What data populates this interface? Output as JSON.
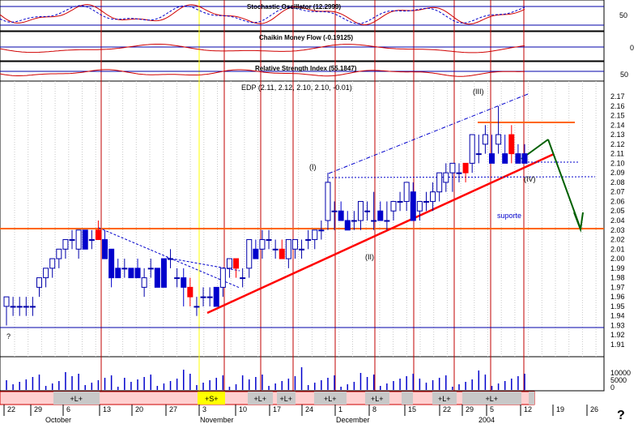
{
  "chart_data": {
    "type": "candlestick",
    "title": "EDP (2.11, 2.12, 2.10, 2.10, -0.01)",
    "price_axis": {
      "ylim": [
        1.9,
        2.18
      ],
      "ticks": [
        "2.17",
        "2.16",
        "2.15",
        "2.14",
        "2.13",
        "2.12",
        "2.11",
        "2.10",
        "2.09",
        "2.08",
        "2.07",
        "2.06",
        "2.05",
        "2.04",
        "2.03",
        "2.02",
        "2.01",
        "2.00",
        "1.99",
        "1.98",
        "1.97",
        "1.96",
        "1.95",
        "1.94",
        "1.93",
        "1.92",
        "1.91"
      ]
    },
    "volume_axis": {
      "ticks": [
        "10000",
        "5000",
        "0"
      ]
    },
    "indicators": [
      {
        "name": "Stochastic Oscillator (12.2999)",
        "axis_label": "50"
      },
      {
        "name": "Chaikin Money Flow (-0.19125)",
        "axis_label": "0"
      },
      {
        "name": "Relative Strength Index (55.1847)",
        "axis_label": "50"
      }
    ],
    "date_ticks": [
      "22",
      "29",
      "6",
      "13",
      "20",
      "27",
      "3",
      "10",
      "17",
      "24",
      "1",
      "8",
      "15",
      "22",
      "29",
      "5",
      "12",
      "19",
      "26"
    ],
    "month_labels": [
      "October",
      "November",
      "December",
      "2004"
    ],
    "candles": [
      [
        1.95,
        1.96,
        1.93,
        1.96
      ],
      [
        1.95,
        1.96,
        1.94,
        1.95
      ],
      [
        1.95,
        1.96,
        1.94,
        1.95
      ],
      [
        1.95,
        1.96,
        1.94,
        1.95
      ],
      [
        1.95,
        1.96,
        1.94,
        1.95
      ],
      [
        1.97,
        1.98,
        1.96,
        1.98
      ],
      [
        1.98,
        1.99,
        1.97,
        1.99
      ],
      [
        1.99,
        2.0,
        1.98,
        2.0
      ],
      [
        2.0,
        2.01,
        1.99,
        2.01
      ],
      [
        2.01,
        2.02,
        2.0,
        2.02
      ],
      [
        2.02,
        2.03,
        2.01,
        2.02
      ],
      [
        2.01,
        2.03,
        2.0,
        2.03
      ],
      [
        2.03,
        2.03,
        2.01,
        2.01
      ],
      [
        2.02,
        2.03,
        2.01,
        2.02
      ],
      [
        2.03,
        2.04,
        2.02,
        2.02
      ],
      [
        2.02,
        2.03,
        2.0,
        2.0
      ],
      [
        2.01,
        2.01,
        1.97,
        1.98
      ],
      [
        1.99,
        2.0,
        1.98,
        1.98
      ],
      [
        1.99,
        2.0,
        1.98,
        1.99
      ],
      [
        1.99,
        1.99,
        1.98,
        1.98
      ],
      [
        1.99,
        2.0,
        1.98,
        1.98
      ],
      [
        1.97,
        1.99,
        1.96,
        1.98
      ],
      [
        1.99,
        2.0,
        1.98,
        1.99
      ],
      [
        1.99,
        1.99,
        1.97,
        1.97
      ],
      [
        2.0,
        2.0,
        1.97,
        1.97
      ],
      [
        2.0,
        2.01,
        1.99,
        2.0
      ],
      [
        1.98,
        1.99,
        1.97,
        1.98
      ],
      [
        1.98,
        1.99,
        1.95,
        1.97
      ],
      [
        1.97,
        1.98,
        1.95,
        1.96
      ],
      [
        1.95,
        1.96,
        1.94,
        1.95
      ],
      [
        1.96,
        1.97,
        1.95,
        1.96
      ],
      [
        1.96,
        1.97,
        1.95,
        1.96
      ],
      [
        1.97,
        1.97,
        1.95,
        1.95
      ],
      [
        1.97,
        1.99,
        1.96,
        1.99
      ],
      [
        1.99,
        2.0,
        1.98,
        2.0
      ],
      [
        2.0,
        2.0,
        1.98,
        1.99
      ],
      [
        1.98,
        1.99,
        1.97,
        1.98
      ],
      [
        1.99,
        2.02,
        1.98,
        2.02
      ],
      [
        2.01,
        2.02,
        2.0,
        2.0
      ],
      [
        2.01,
        2.03,
        2.0,
        2.02
      ],
      [
        2.02,
        2.03,
        2.01,
        2.02
      ],
      [
        2.01,
        2.02,
        2.0,
        2.01
      ],
      [
        2.01,
        2.02,
        2.0,
        2.0
      ],
      [
        2.0,
        2.02,
        1.99,
        2.02
      ],
      [
        2.01,
        2.02,
        2.0,
        2.02
      ],
      [
        2.01,
        2.02,
        2.0,
        2.01
      ],
      [
        2.02,
        2.03,
        2.01,
        2.02
      ],
      [
        2.02,
        2.03,
        2.01,
        2.03
      ],
      [
        2.03,
        2.04,
        2.02,
        2.03
      ],
      [
        2.04,
        2.09,
        2.03,
        2.08
      ],
      [
        2.05,
        2.06,
        2.03,
        2.05
      ],
      [
        2.05,
        2.06,
        2.04,
        2.04
      ],
      [
        2.04,
        2.05,
        2.03,
        2.03
      ],
      [
        2.04,
        2.05,
        2.03,
        2.04
      ],
      [
        2.04,
        2.06,
        2.03,
        2.06
      ],
      [
        2.05,
        2.06,
        2.04,
        2.05
      ],
      [
        2.04,
        2.07,
        2.03,
        2.04
      ],
      [
        2.05,
        2.06,
        2.04,
        2.04
      ],
      [
        2.04,
        2.06,
        2.03,
        2.04
      ],
      [
        2.05,
        2.06,
        2.04,
        2.06
      ],
      [
        2.06,
        2.07,
        2.05,
        2.06
      ],
      [
        2.06,
        2.08,
        2.05,
        2.08
      ],
      [
        2.07,
        2.08,
        2.04,
        2.04
      ],
      [
        2.05,
        2.06,
        2.04,
        2.06
      ],
      [
        2.06,
        2.07,
        2.05,
        2.06
      ],
      [
        2.06,
        2.08,
        2.05,
        2.07
      ],
      [
        2.07,
        2.09,
        2.06,
        2.09
      ],
      [
        2.08,
        2.1,
        2.07,
        2.09
      ],
      [
        2.09,
        2.1,
        2.07,
        2.1
      ],
      [
        2.09,
        2.1,
        2.08,
        2.09
      ],
      [
        2.1,
        2.1,
        2.08,
        2.09
      ],
      [
        2.1,
        2.13,
        2.09,
        2.13
      ],
      [
        2.11,
        2.13,
        2.1,
        2.11
      ],
      [
        2.12,
        2.14,
        2.11,
        2.13
      ],
      [
        2.11,
        2.13,
        2.1,
        2.1
      ],
      [
        2.12,
        2.16,
        2.11,
        2.13
      ],
      [
        2.11,
        2.13,
        2.1,
        2.1
      ],
      [
        2.13,
        2.14,
        2.1,
        2.11
      ],
      [
        2.11,
        2.12,
        2.1,
        2.1
      ],
      [
        2.11,
        2.12,
        2.1,
        2.1
      ]
    ],
    "annotations": {
      "waves": [
        "(I)",
        "(II)",
        "(III)",
        "(IV)"
      ],
      "support_label": "suporte",
      "resistance_level": 2.14,
      "support_level": 2.03,
      "low_marker": "?"
    },
    "signal_bar": [
      "+L+",
      "+S+",
      "+L+",
      "+L+",
      "+L+",
      "+L+",
      "+L+",
      "+L+",
      "+L+",
      "+L+"
    ],
    "corner_mark": "?"
  }
}
